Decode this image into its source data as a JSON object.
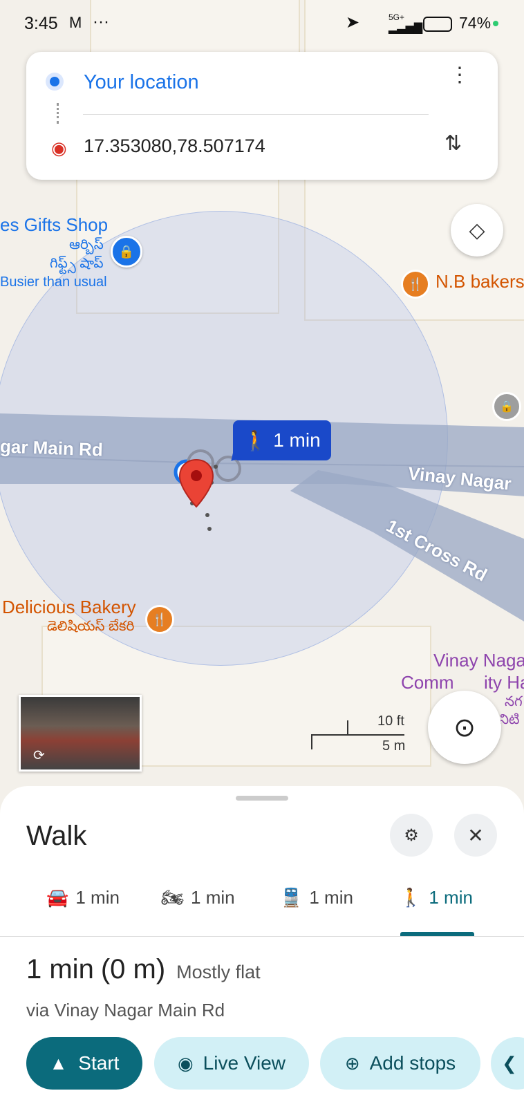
{
  "status_bar": {
    "time": "3:45",
    "mail_icon": "M",
    "more": "···",
    "network": "5G+",
    "battery": "74%"
  },
  "directions": {
    "origin": "Your location",
    "destination": "17.353080,78.507174"
  },
  "map": {
    "pois": {
      "gifts_shop": "es Gifts Shop",
      "gifts_shop_telugu_1": "ఆర్బిస్",
      "gifts_shop_telugu_2": "గిఫ్ట్స్ షాప్",
      "busy": "Busier than usual",
      "nb_bakers": "N.B bakers",
      "delicious_bakery": "Delicious Bakery",
      "delicious_bakery_telugu": "డెలిషియస్ బేకరి",
      "community_1": "Vinay Naga",
      "community_2a": "Comm",
      "community_2b": "ity Ha",
      "community_telugu_1": "నగ",
      "community_telugu_2": "నిటి"
    },
    "roads": {
      "main_rd": "gar Main Rd",
      "vinay_nagar": "Vinay Nagar",
      "cross_rd": "1st Cross Rd"
    },
    "walk_badge": "1 min",
    "scale_ft": "10 ft",
    "scale_m": "5 m"
  },
  "sheet": {
    "title": "Walk",
    "modes": [
      {
        "icon": "car-icon",
        "time": "1 min"
      },
      {
        "icon": "motorbike-icon",
        "time": "1 min"
      },
      {
        "icon": "transit-icon",
        "time": "1 min"
      },
      {
        "icon": "walk-icon",
        "time": "1 min"
      }
    ],
    "summary_time": "1 min",
    "summary_dist": "(0 m)",
    "terrain": "Mostly flat",
    "via": "via Vinay Nagar Main Rd",
    "actions": {
      "start": "Start",
      "live_view": "Live View",
      "add_stops": "Add stops"
    }
  },
  "colors": {
    "accent": "#1a73e8",
    "teal": "#0b6b7c",
    "pin_red": "#d93025",
    "badge_blue": "#1a49c9"
  }
}
